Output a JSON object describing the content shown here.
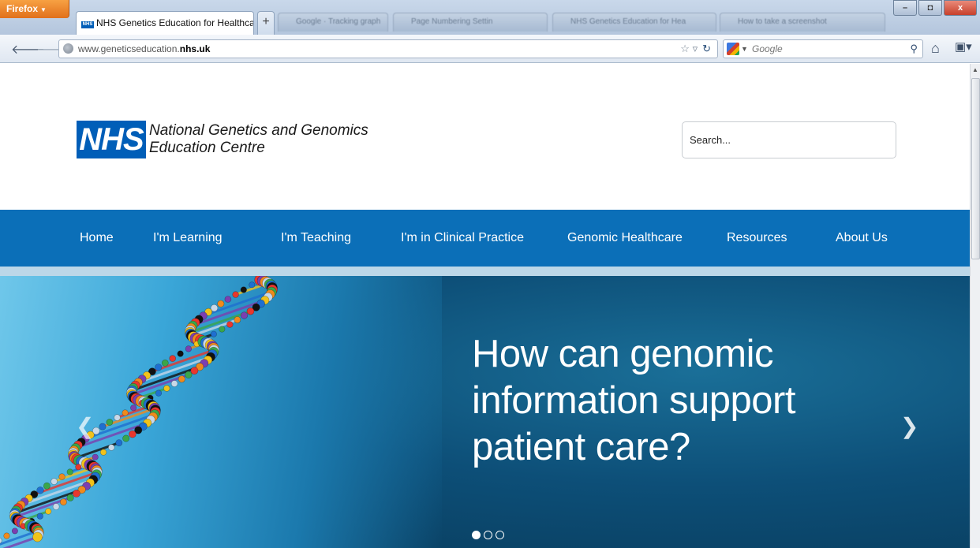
{
  "browser": {
    "menu_label": "Firefox",
    "active_tab_title": "NHS Genetics Education for Healthcare",
    "tab_favicon_text": "NHS",
    "new_tab_label": "+",
    "background_tabs": [
      "Google · Tracking graph",
      "Page Numbering Settin",
      "NHS Genetics Education for Hea",
      "How to take a screenshot"
    ],
    "window_controls": {
      "minimize": "–",
      "restore": "◘",
      "close": "x"
    },
    "url_prefix": "www.geneticseducation.",
    "url_domain": "nhs.uk",
    "search_engine_placeholder": "Google"
  },
  "site": {
    "logo_mark": "NHS",
    "logo_line1": "National Genetics and Genomics",
    "logo_line2": "Education Centre",
    "search_placeholder": "Search...",
    "nav": [
      "Home",
      "I'm Learning",
      "I'm Teaching",
      "I'm in Clinical Practice",
      "Genomic Healthcare",
      "Resources",
      "About Us"
    ],
    "hero_heading": "How can genomic information support patient care?",
    "slides_total": 3,
    "slide_active": 1
  },
  "colors": {
    "nhs_blue": "#005eb8",
    "nav_bg": "#0b6fb8",
    "hero_bg": "#0d4f78",
    "firefox_orange": "#e1701b"
  }
}
